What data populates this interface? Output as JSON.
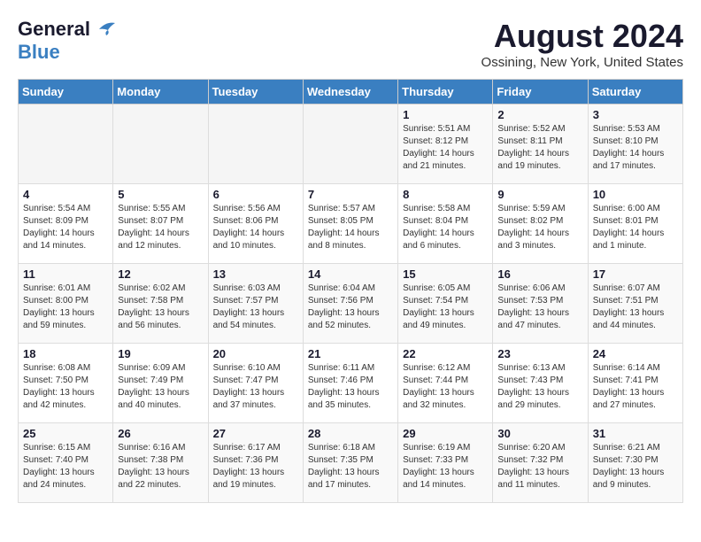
{
  "header": {
    "logo_general": "General",
    "logo_blue": "Blue",
    "month_year": "August 2024",
    "location": "Ossining, New York, United States"
  },
  "weekdays": [
    "Sunday",
    "Monday",
    "Tuesday",
    "Wednesday",
    "Thursday",
    "Friday",
    "Saturday"
  ],
  "weeks": [
    [
      {
        "day": "",
        "info": ""
      },
      {
        "day": "",
        "info": ""
      },
      {
        "day": "",
        "info": ""
      },
      {
        "day": "",
        "info": ""
      },
      {
        "day": "1",
        "info": "Sunrise: 5:51 AM\nSunset: 8:12 PM\nDaylight: 14 hours\nand 21 minutes."
      },
      {
        "day": "2",
        "info": "Sunrise: 5:52 AM\nSunset: 8:11 PM\nDaylight: 14 hours\nand 19 minutes."
      },
      {
        "day": "3",
        "info": "Sunrise: 5:53 AM\nSunset: 8:10 PM\nDaylight: 14 hours\nand 17 minutes."
      }
    ],
    [
      {
        "day": "4",
        "info": "Sunrise: 5:54 AM\nSunset: 8:09 PM\nDaylight: 14 hours\nand 14 minutes."
      },
      {
        "day": "5",
        "info": "Sunrise: 5:55 AM\nSunset: 8:07 PM\nDaylight: 14 hours\nand 12 minutes."
      },
      {
        "day": "6",
        "info": "Sunrise: 5:56 AM\nSunset: 8:06 PM\nDaylight: 14 hours\nand 10 minutes."
      },
      {
        "day": "7",
        "info": "Sunrise: 5:57 AM\nSunset: 8:05 PM\nDaylight: 14 hours\nand 8 minutes."
      },
      {
        "day": "8",
        "info": "Sunrise: 5:58 AM\nSunset: 8:04 PM\nDaylight: 14 hours\nand 6 minutes."
      },
      {
        "day": "9",
        "info": "Sunrise: 5:59 AM\nSunset: 8:02 PM\nDaylight: 14 hours\nand 3 minutes."
      },
      {
        "day": "10",
        "info": "Sunrise: 6:00 AM\nSunset: 8:01 PM\nDaylight: 14 hours\nand 1 minute."
      }
    ],
    [
      {
        "day": "11",
        "info": "Sunrise: 6:01 AM\nSunset: 8:00 PM\nDaylight: 13 hours\nand 59 minutes."
      },
      {
        "day": "12",
        "info": "Sunrise: 6:02 AM\nSunset: 7:58 PM\nDaylight: 13 hours\nand 56 minutes."
      },
      {
        "day": "13",
        "info": "Sunrise: 6:03 AM\nSunset: 7:57 PM\nDaylight: 13 hours\nand 54 minutes."
      },
      {
        "day": "14",
        "info": "Sunrise: 6:04 AM\nSunset: 7:56 PM\nDaylight: 13 hours\nand 52 minutes."
      },
      {
        "day": "15",
        "info": "Sunrise: 6:05 AM\nSunset: 7:54 PM\nDaylight: 13 hours\nand 49 minutes."
      },
      {
        "day": "16",
        "info": "Sunrise: 6:06 AM\nSunset: 7:53 PM\nDaylight: 13 hours\nand 47 minutes."
      },
      {
        "day": "17",
        "info": "Sunrise: 6:07 AM\nSunset: 7:51 PM\nDaylight: 13 hours\nand 44 minutes."
      }
    ],
    [
      {
        "day": "18",
        "info": "Sunrise: 6:08 AM\nSunset: 7:50 PM\nDaylight: 13 hours\nand 42 minutes."
      },
      {
        "day": "19",
        "info": "Sunrise: 6:09 AM\nSunset: 7:49 PM\nDaylight: 13 hours\nand 40 minutes."
      },
      {
        "day": "20",
        "info": "Sunrise: 6:10 AM\nSunset: 7:47 PM\nDaylight: 13 hours\nand 37 minutes."
      },
      {
        "day": "21",
        "info": "Sunrise: 6:11 AM\nSunset: 7:46 PM\nDaylight: 13 hours\nand 35 minutes."
      },
      {
        "day": "22",
        "info": "Sunrise: 6:12 AM\nSunset: 7:44 PM\nDaylight: 13 hours\nand 32 minutes."
      },
      {
        "day": "23",
        "info": "Sunrise: 6:13 AM\nSunset: 7:43 PM\nDaylight: 13 hours\nand 29 minutes."
      },
      {
        "day": "24",
        "info": "Sunrise: 6:14 AM\nSunset: 7:41 PM\nDaylight: 13 hours\nand 27 minutes."
      }
    ],
    [
      {
        "day": "25",
        "info": "Sunrise: 6:15 AM\nSunset: 7:40 PM\nDaylight: 13 hours\nand 24 minutes."
      },
      {
        "day": "26",
        "info": "Sunrise: 6:16 AM\nSunset: 7:38 PM\nDaylight: 13 hours\nand 22 minutes."
      },
      {
        "day": "27",
        "info": "Sunrise: 6:17 AM\nSunset: 7:36 PM\nDaylight: 13 hours\nand 19 minutes."
      },
      {
        "day": "28",
        "info": "Sunrise: 6:18 AM\nSunset: 7:35 PM\nDaylight: 13 hours\nand 17 minutes."
      },
      {
        "day": "29",
        "info": "Sunrise: 6:19 AM\nSunset: 7:33 PM\nDaylight: 13 hours\nand 14 minutes."
      },
      {
        "day": "30",
        "info": "Sunrise: 6:20 AM\nSunset: 7:32 PM\nDaylight: 13 hours\nand 11 minutes."
      },
      {
        "day": "31",
        "info": "Sunrise: 6:21 AM\nSunset: 7:30 PM\nDaylight: 13 hours\nand 9 minutes."
      }
    ]
  ]
}
